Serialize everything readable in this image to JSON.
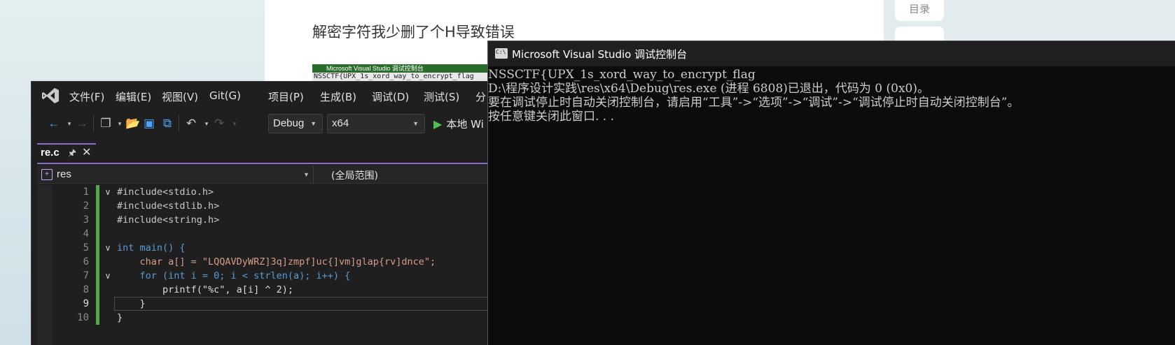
{
  "article": {
    "heading": "解密字符我少删了个H导致错误",
    "thumbnail_title": "Microsoft Visual Studio 调试控制台",
    "thumbnail_text": "NSSCTF{UPX_1s_xord_way_to_encrypt_flag"
  },
  "sidebar": {
    "toc_label": "目录"
  },
  "vs": {
    "menu": [
      "文件(F)",
      "编辑(E)",
      "视图(V)",
      "Git(G)",
      "项目(P)",
      "生成(B)",
      "调试(D)",
      "测试(S)",
      "分"
    ],
    "toolbar": {
      "config": "Debug",
      "platform": "x64",
      "run_label": "本地 Wi"
    },
    "tab": {
      "filename": "re.c"
    },
    "nav": {
      "scope": "res",
      "global_scope": "(全局范围)"
    },
    "code_lines": [
      {
        "num": "1",
        "text": "#include<stdio.h>"
      },
      {
        "num": "2",
        "text": "#include<stdlib.h>"
      },
      {
        "num": "3",
        "text": "#include<string.h>"
      },
      {
        "num": "4",
        "text": ""
      },
      {
        "num": "5",
        "text": "int main() {"
      },
      {
        "num": "6",
        "text": "    char a[] = \"LQQAVDyWRZ]3q]zmpf]uc{]vm]glap{rv]dnce\";"
      },
      {
        "num": "7",
        "text": "    for (int i = 0; i < strlen(a); i++) {"
      },
      {
        "num": "8",
        "text": "        printf(\"%c\", a[i] ^ 2);"
      },
      {
        "num": "9",
        "text": "    }"
      },
      {
        "num": "10",
        "text": "}"
      }
    ]
  },
  "console": {
    "title": "Microsoft Visual Studio 调试控制台",
    "lines": [
      "NSSCTF{UPX_1s_xord_way_to_encrypt_flag",
      "D:\\程序设计实践\\res\\x64\\Debug\\res.exe (进程 6808)已退出，代码为 0 (0x0)。",
      "要在调试停止时自动关闭控制台，请启用“工具”->“选项”->“调试”->“调试停止时自动关闭控制台”。",
      "按任意键关闭此窗口. . ."
    ]
  },
  "colors": {
    "accent_purple": "#8c6bd0",
    "change_green": "#57a64a",
    "keyword_blue": "#569cd6",
    "string_orange": "#d69d85"
  },
  "icons": [
    "visual-studio-logo-icon",
    "back-icon",
    "forward-icon",
    "new-project-icon",
    "open-folder-icon",
    "save-icon",
    "save-all-icon",
    "undo-icon",
    "redo-icon",
    "play-icon",
    "pin-icon",
    "close-icon",
    "console-app-icon"
  ]
}
